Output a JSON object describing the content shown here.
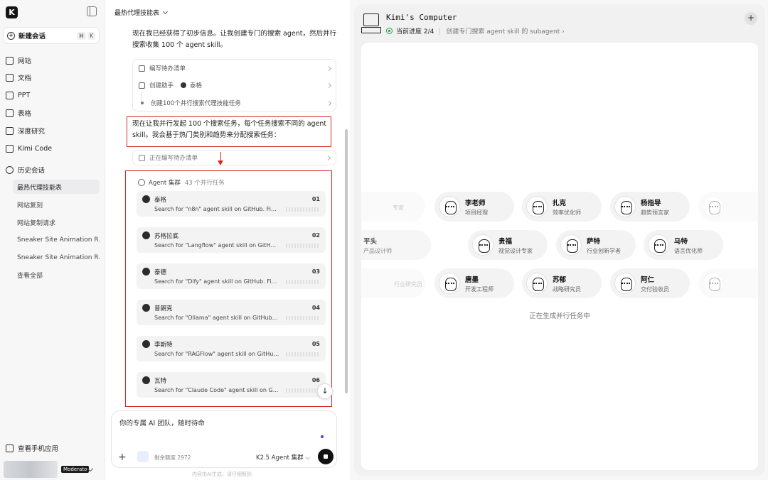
{
  "sidebar": {
    "logo": "K",
    "new_chat": "新建会话",
    "shortcut": [
      "⌘",
      "K"
    ],
    "nav": [
      "网站",
      "文档",
      "PPT",
      "表格",
      "深度研究",
      "Kimi Code"
    ],
    "history_label": "历史会话",
    "history": [
      "最热代理技能表",
      "网站复刻",
      "网站复制请求",
      "Sneaker Site Animation R...",
      "Sneaker Site Animation R...",
      "查看全部"
    ],
    "mobile": "查看手机应用",
    "plan": "Moderato"
  },
  "chat": {
    "title": "最热代理技能表",
    "intro": "现在我已经获得了初步信息。让我创建专门的搜索 agent，然后并行搜索收集 100 个 agent skill。",
    "todo": [
      "编写待办清单",
      "创建助手",
      "泰格",
      "创建100个并行搜索代理技能任务"
    ],
    "highlight": "现在让我并行发起 100 个搜索任务，每个任务搜索不同的 agent skill。我会基于热门类别和趋势来分配搜索任务：",
    "writing": "正在编写待办清单",
    "swarm_title": "Agent 集群",
    "swarm_count": "43 个并行任务",
    "tasks": [
      {
        "name": "泰格",
        "num": "01",
        "desc": "Search for \"n8n\" agent skill on GitHub. Find: ..."
      },
      {
        "name": "苏格拉底",
        "num": "02",
        "desc": "Search for \"Langflow\" agent skill on GitHub. ..."
      },
      {
        "name": "泰德",
        "num": "03",
        "desc": "Search for \"Dify\" agent skill on GitHub. Find:..."
      },
      {
        "name": "普朗克",
        "num": "04",
        "desc": "Search for \"Ollama\" agent skill on GitHub. Fi..."
      },
      {
        "name": "李斯特",
        "num": "05",
        "desc": "Search for \"RAGFlow\" agent skill on GitHub. ..."
      },
      {
        "name": "瓦特",
        "num": "06",
        "desc": "Search for \"Claude Code\" agent skill on GitH..."
      }
    ],
    "scroll_down": "↓",
    "composer_placeholder": "你的专属 AI 团队，随时待命",
    "composer_plus": "+",
    "quota": "剩余额度 2972",
    "model": "K2.5 Agent 集群 ⌵",
    "footnote": "内容由AI生成，请仔细甄别"
  },
  "computer": {
    "title": "Kimi's Computer",
    "progress": "当前进度 2/4",
    "current_task": "创建专门搜索 agent skill 的 subagent ›",
    "add": "+",
    "row1": [
      {
        "name": "",
        "role": "专家"
      },
      {
        "name": "李老师",
        "role": "项目经理"
      },
      {
        "name": "扎克",
        "role": "效率优化师"
      },
      {
        "name": "杨指导",
        "role": "趋势预言家"
      },
      {
        "name": "",
        "role": ""
      }
    ],
    "row2": [
      {
        "name": "平头",
        "role": "产品设计师"
      },
      {
        "name": "贵福",
        "role": "视觉设计专家"
      },
      {
        "name": "萨特",
        "role": "行业创新学者"
      },
      {
        "name": "马特",
        "role": "语言优化师"
      }
    ],
    "row3": [
      {
        "name": "",
        "role": "行业研究员"
      },
      {
        "name": "唐墨",
        "role": "开发工程师"
      },
      {
        "name": "苏郁",
        "role": "战略研究员"
      },
      {
        "name": "阿仁",
        "role": "交付验收员"
      },
      {
        "name": "",
        "role": ""
      }
    ],
    "status": "正在生成并行任务中"
  }
}
